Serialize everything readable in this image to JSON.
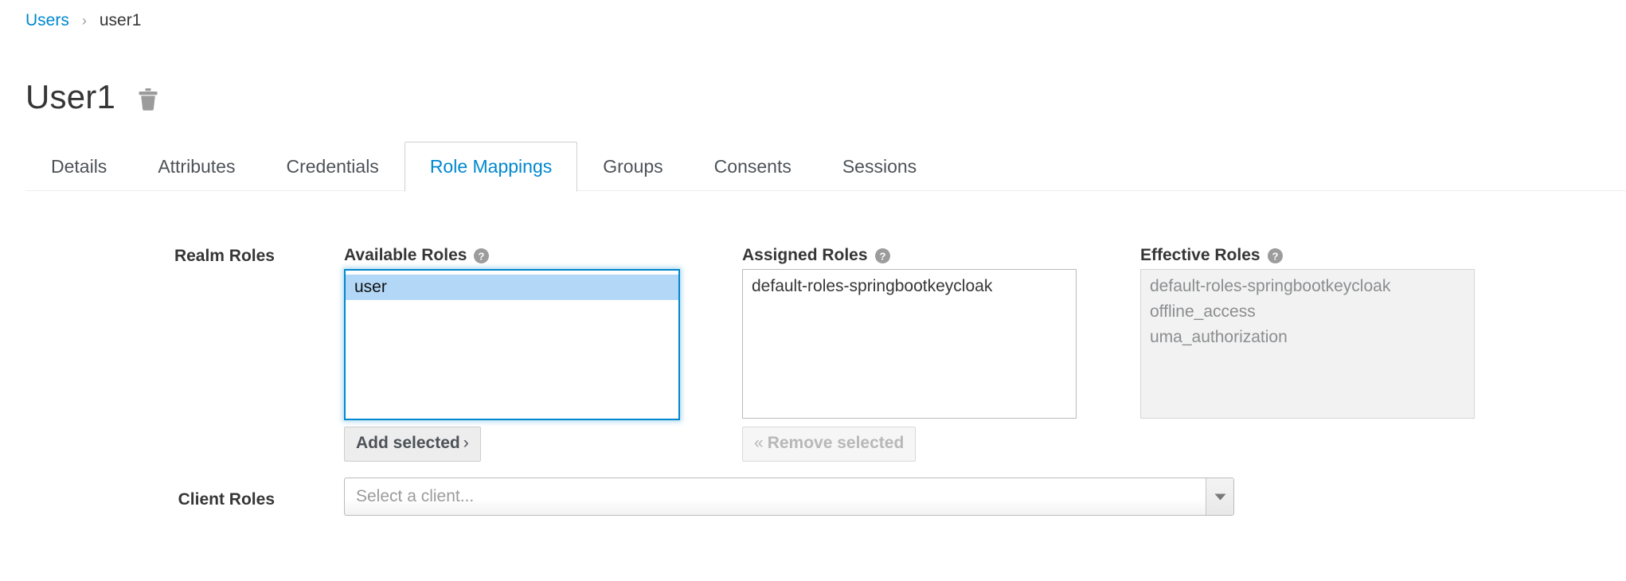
{
  "breadcrumb": {
    "parent": "Users",
    "separator": "›",
    "current": "user1"
  },
  "header": {
    "title": "User1",
    "delete_icon": "trash-icon"
  },
  "tabs": [
    {
      "label": "Details",
      "active": false
    },
    {
      "label": "Attributes",
      "active": false
    },
    {
      "label": "Credentials",
      "active": false
    },
    {
      "label": "Role Mappings",
      "active": true
    },
    {
      "label": "Groups",
      "active": false
    },
    {
      "label": "Consents",
      "active": false
    },
    {
      "label": "Sessions",
      "active": false
    }
  ],
  "realm_roles": {
    "row_label": "Realm Roles",
    "available": {
      "heading": "Available Roles",
      "help_icon": "help-circle-icon",
      "options": [
        {
          "label": "user",
          "selected": true
        }
      ],
      "focused": true,
      "button": {
        "label": "Add selected",
        "chevron": "›",
        "disabled": false
      }
    },
    "assigned": {
      "heading": "Assigned Roles",
      "help_icon": "help-circle-icon",
      "options": [
        {
          "label": "default-roles-springbootkeycloak",
          "selected": false
        }
      ],
      "button": {
        "label": "Remove selected",
        "chevron": "«",
        "disabled": true
      }
    },
    "effective": {
      "heading": "Effective Roles",
      "help_icon": "help-circle-icon",
      "readonly": true,
      "options": [
        {
          "label": "default-roles-springbootkeycloak",
          "selected": false
        },
        {
          "label": "offline_access",
          "selected": false
        },
        {
          "label": "uma_authorization",
          "selected": false
        }
      ]
    }
  },
  "client_roles": {
    "row_label": "Client Roles",
    "select": {
      "placeholder": "Select a client...",
      "value": "",
      "caret_icon": "caret-down-icon"
    }
  },
  "colors": {
    "link": "#0088ce",
    "accent": "#0088ce",
    "text": "#363636",
    "muted": "#8b8d8f",
    "selection": "#b3d8f7",
    "border": "#bbbbbb",
    "readonly_bg": "#f2f2f2"
  }
}
